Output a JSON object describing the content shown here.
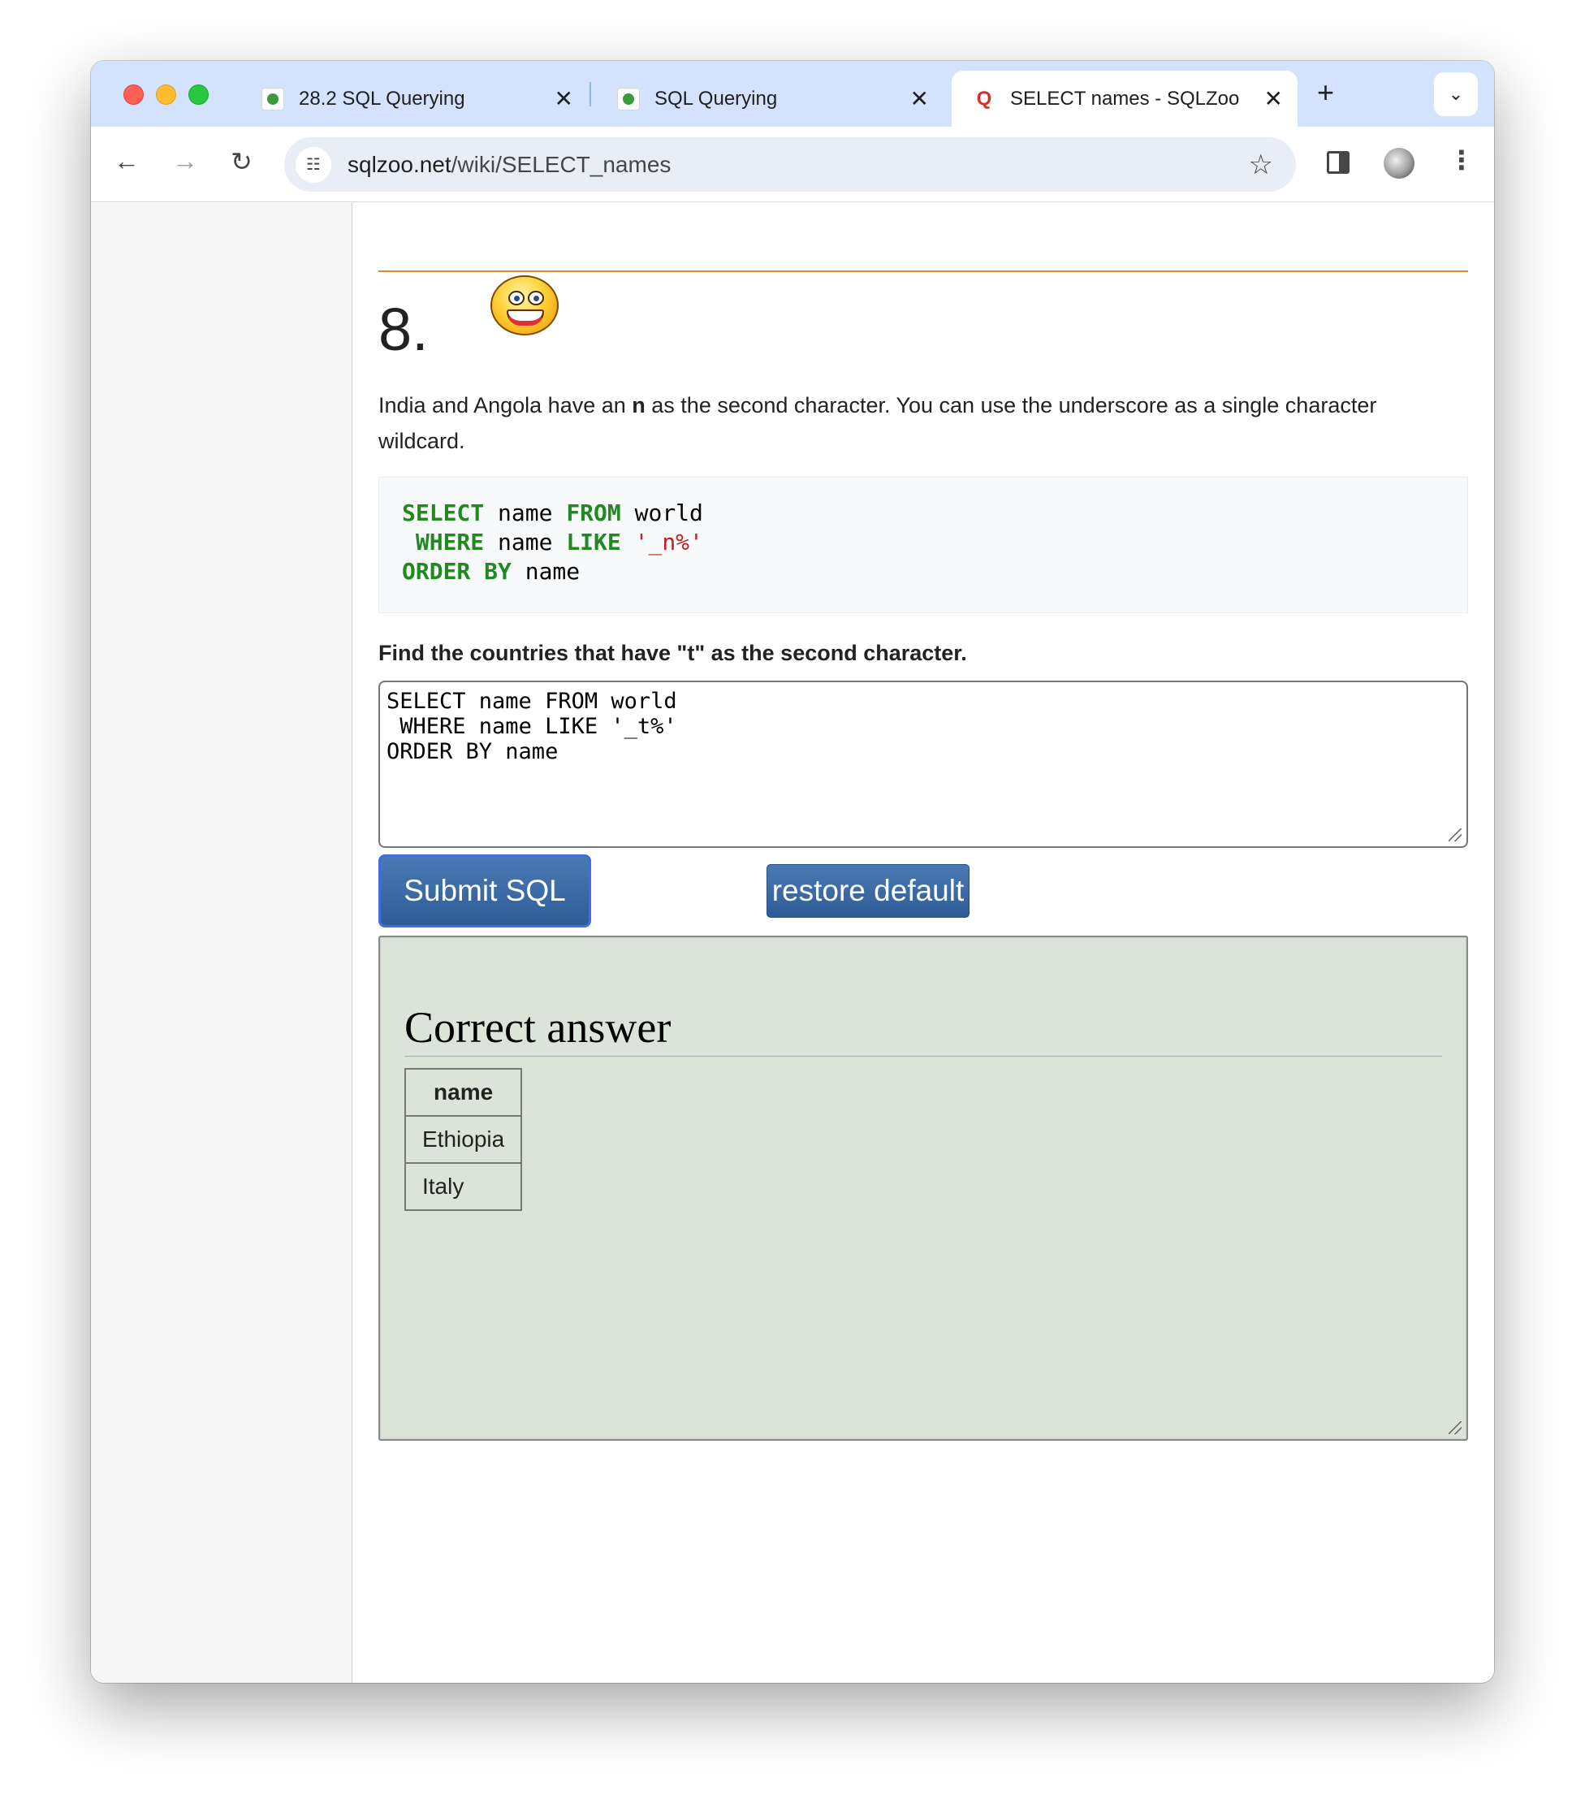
{
  "browser": {
    "tabs": [
      {
        "label": "28.2 SQL Querying"
      },
      {
        "label": "SQL Querying"
      },
      {
        "label": "SELECT names - SQLZoo",
        "active": true
      }
    ],
    "url_host": "sqlzoo.net",
    "url_path": "/wiki/SELECT_names"
  },
  "question": {
    "number": "8.",
    "desc_pre": "India and Angola have an ",
    "desc_bold": "n",
    "desc_post": " as the second character. You can use the underscore as a single character wildcard.",
    "example": {
      "l1_kw1": "SELECT",
      "l1_t1": " name ",
      "l1_kw2": "FROM",
      "l1_t2": " world",
      "l2_kw1": " WHERE",
      "l2_t1": " name ",
      "l2_kw2": "LIKE",
      "l2_t2": " ",
      "l2_str": "'_n%'",
      "l3_kw1": "ORDER BY",
      "l3_t1": " name"
    },
    "task": "Find the countries that have \"t\" as the second character.",
    "sql_value": "SELECT name FROM world\n WHERE name LIKE '_t%'\nORDER BY name"
  },
  "buttons": {
    "submit": "Submit SQL",
    "restore": "restore default"
  },
  "result": {
    "heading": "Correct answer",
    "columns": [
      "name"
    ],
    "rows": [
      "Ethiopia",
      "Italy"
    ]
  },
  "colors": {
    "tabstrip": "#d3e3fd",
    "keyword": "#228822",
    "string": "#bb2222",
    "button": "#2e5c96",
    "result_bg": "#dce4da",
    "rule": "#e0883a"
  }
}
